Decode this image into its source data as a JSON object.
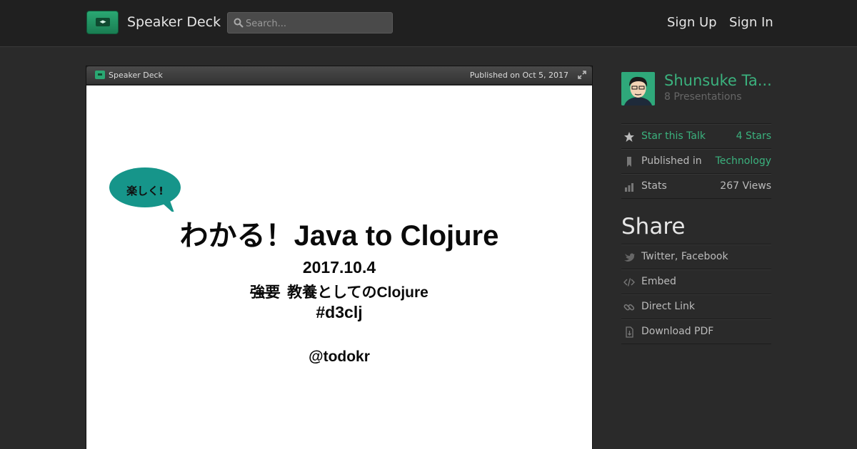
{
  "header": {
    "brand": "Speaker Deck",
    "search_placeholder": "Search...",
    "sign_up": "Sign Up",
    "sign_in": "Sign In"
  },
  "viewer": {
    "bar_brand": "Speaker Deck",
    "published": "Published on Oct 5, 2017"
  },
  "slide": {
    "bubble": "楽しく!",
    "title": "わかる！Java to Clojure",
    "date": "2017.10.4",
    "subtitle_struck": "強要",
    "subtitle": "教養としてのClojure",
    "hashtag": "#d3clj",
    "handle": "@todokr"
  },
  "sidebar": {
    "author_name": "Shunsuke Ta...",
    "author_count": "8 Presentations",
    "star_label": "Star this Talk",
    "star_value": "4 Stars",
    "published_label": "Published in",
    "published_value": "Technology",
    "stats_label": "Stats",
    "stats_value": "267 Views",
    "share_heading": "Share",
    "share_items": [
      "Twitter, Facebook",
      "Embed",
      "Direct Link",
      "Download PDF"
    ]
  },
  "colors": {
    "accent": "#3bb27e",
    "header_bg": "#202020",
    "page_bg": "#2a2a2a",
    "bubble": "#16958a"
  },
  "icons": [
    "search-icon",
    "expand-icon",
    "star-icon",
    "bookmark-icon",
    "bar-chart-icon",
    "twitter-bird-icon",
    "code-icon",
    "link-icon",
    "download-pdf-icon"
  ]
}
